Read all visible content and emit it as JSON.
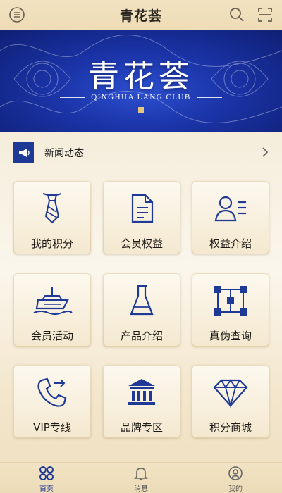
{
  "header": {
    "title": "青花荟"
  },
  "banner": {
    "brand": "青花荟",
    "subtitle": "QINGHUA LANG CLUB"
  },
  "news": {
    "label": "新闻动态"
  },
  "grid": [
    {
      "label": "我的积分",
      "icon": "tie-icon"
    },
    {
      "label": "会员权益",
      "icon": "document-icon"
    },
    {
      "label": "权益介绍",
      "icon": "user-list-icon"
    },
    {
      "label": "会员活动",
      "icon": "cruise-ship-icon"
    },
    {
      "label": "产品介绍",
      "icon": "flask-icon"
    },
    {
      "label": "真伪查询",
      "icon": "grid-network-icon"
    },
    {
      "label": "VIP专线",
      "icon": "phone-icon"
    },
    {
      "label": "品牌专区",
      "icon": "bank-building-icon"
    },
    {
      "label": "积分商城",
      "icon": "diamond-icon"
    }
  ],
  "nav": [
    {
      "label": "首页",
      "icon": "home-grid-icon",
      "active": true
    },
    {
      "label": "消息",
      "icon": "bell-icon",
      "active": false
    },
    {
      "label": "我的",
      "icon": "user-circle-icon",
      "active": false
    }
  ],
  "colors": {
    "accent": "#1f3a96",
    "banner": "#1a33a6",
    "gold": "#e6c77d"
  }
}
